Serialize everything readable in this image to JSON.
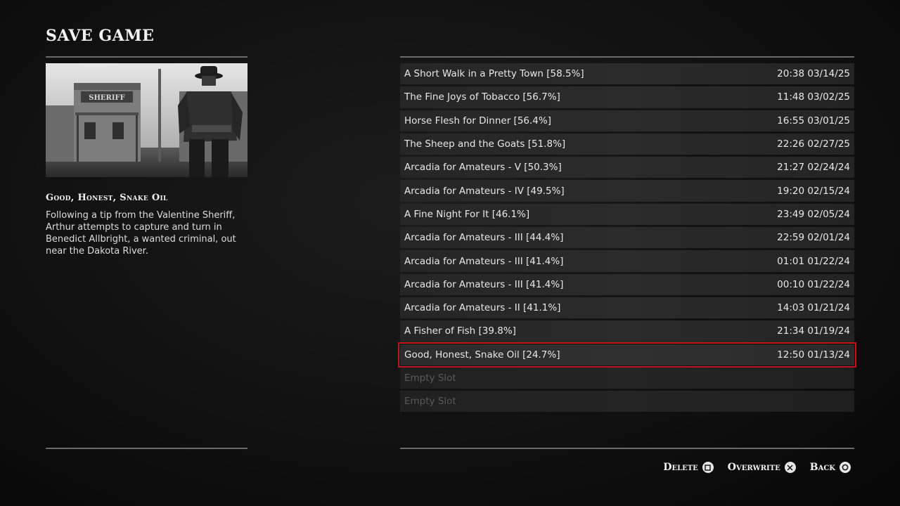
{
  "header": {
    "title": "SAVE GAME"
  },
  "mission": {
    "title": "Good, Honest, Snake Oil",
    "description": "Following a tip from the Valentine Sheriff, Arthur attempts to capture and turn in Benedict Allbright, a wanted criminal, out near the Dakota River.",
    "image_sign_text": "SHERIFF"
  },
  "slots": [
    {
      "name": "A Short Walk in a Pretty Town [58.5%]",
      "datetime": "20:38 03/14/25"
    },
    {
      "name": "The Fine Joys of Tobacco [56.7%]",
      "datetime": "11:48 03/02/25"
    },
    {
      "name": "Horse Flesh for Dinner [56.4%]",
      "datetime": "16:55 03/01/25"
    },
    {
      "name": "The Sheep and the Goats [51.8%]",
      "datetime": "22:26 02/27/25"
    },
    {
      "name": "Arcadia for Amateurs - V [50.3%]",
      "datetime": "21:27 02/24/24"
    },
    {
      "name": "Arcadia for Amateurs - IV [49.5%]",
      "datetime": "19:20 02/15/24"
    },
    {
      "name": "A Fine Night For It [46.1%]",
      "datetime": "23:49 02/05/24"
    },
    {
      "name": "Arcadia for Amateurs - III [44.4%]",
      "datetime": "22:59 02/01/24"
    },
    {
      "name": "Arcadia for Amateurs - III [41.4%]",
      "datetime": "01:01 01/22/24"
    },
    {
      "name": "Arcadia for Amateurs - III [41.4%]",
      "datetime": "00:10 01/22/24"
    },
    {
      "name": "Arcadia for Amateurs - II [41.1%]",
      "datetime": "14:03 01/21/24"
    },
    {
      "name": "A Fisher of Fish [39.8%]",
      "datetime": "21:34 01/19/24"
    },
    {
      "name": "Good, Honest, Snake Oil [24.7%]",
      "datetime": "12:50 01/13/24",
      "selected": true
    },
    {
      "name": "Empty Slot",
      "datetime": "",
      "empty": true
    },
    {
      "name": "Empty Slot",
      "datetime": "",
      "empty": true
    }
  ],
  "footer": {
    "delete_label": "Delete",
    "delete_icon": "square-button-icon",
    "overwrite_label": "Overwrite",
    "overwrite_icon": "cross-button-icon",
    "back_label": "Back",
    "back_icon": "circle-button-icon"
  },
  "colors": {
    "selection_outline": "#c0131b",
    "background": "#111111"
  }
}
